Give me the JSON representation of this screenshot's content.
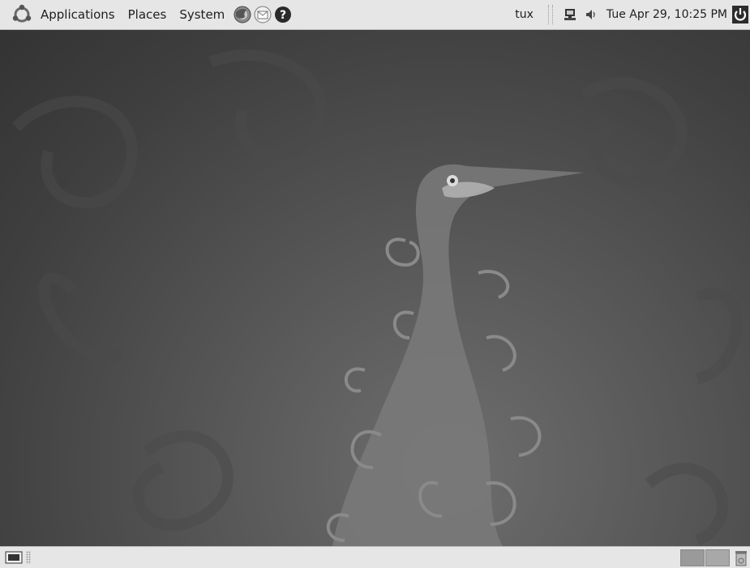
{
  "top_panel": {
    "menu": {
      "applications": "Applications",
      "places": "Places",
      "system": "System"
    },
    "launchers": [
      "web-browser-icon",
      "mail-icon",
      "help-icon"
    ],
    "user": "tux",
    "tray_icons": [
      "network-icon",
      "volume-icon"
    ],
    "clock": "Tue Apr 29, 10:25 PM"
  },
  "bottom_panel": {
    "workspaces": 2,
    "items": [
      "show-desktop-icon",
      "workspace-switcher",
      "trash-icon"
    ]
  },
  "colors": {
    "panel": "#e6e6e6",
    "desktop": "#4a4a4a"
  }
}
